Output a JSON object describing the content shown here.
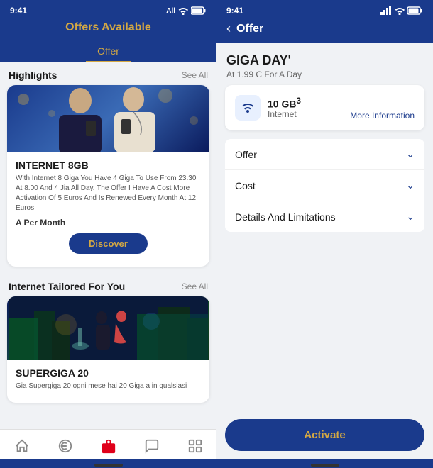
{
  "left": {
    "status": {
      "time": "9:41",
      "carrier": "All",
      "battery": "▮▮▮"
    },
    "title": "Offers Available",
    "tab": "Offer",
    "highlights": {
      "label": "Highlights",
      "see_all": "See All",
      "card1": {
        "title": "INTERNET 8GB",
        "description": "With Internet 8 Giga You Have 4 Giga To Use From 23.30 At 8.00 And 4 Jia All Day. The Offer I Have A Cost More Activation Of 5 Euros And Is Renewed Every Month At 12 Euros",
        "price": "A Per Month",
        "button": "Discover"
      }
    },
    "tailored": {
      "label": "Internet Tailored For You",
      "see_all": "See All",
      "card2": {
        "title": "SUPERGIGA 20",
        "description": "Gia Supergiga 20 ogni mese hai 20 Giga a in qualsiasi"
      }
    },
    "nav": {
      "home": "⌂",
      "euro": "€",
      "gift": "🎁",
      "chat": "💬",
      "grid": "⊞"
    }
  },
  "right": {
    "status": {
      "time": "9:41",
      "signal": "▮▮▮▮",
      "wifi": "WiFi",
      "battery": "▮▮▮"
    },
    "back": "‹",
    "title": "Offer",
    "giga": {
      "title": "GIGA DAY'",
      "subtitle": "At 1.99 C For A Day",
      "gb": "10 GB",
      "superscript": "3",
      "internet": "Internet",
      "more_info": "More Information"
    },
    "accordion": [
      {
        "label": "Offer",
        "id": "offer"
      },
      {
        "label": "Cost",
        "id": "cost"
      },
      {
        "label": "Details And Limitations",
        "id": "details"
      }
    ],
    "activate_button": "Activate"
  }
}
